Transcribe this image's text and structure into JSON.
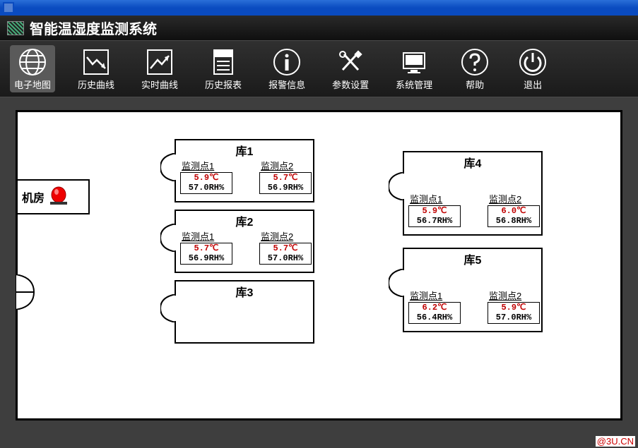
{
  "app": {
    "title": "智能温湿度监测系统"
  },
  "toolbar": {
    "items": [
      {
        "id": "map",
        "label": "电子地图",
        "active": true
      },
      {
        "id": "history-curve",
        "label": "历史曲线",
        "active": false
      },
      {
        "id": "realtime-curve",
        "label": "实时曲线",
        "active": false
      },
      {
        "id": "history-report",
        "label": "历史报表",
        "active": false
      },
      {
        "id": "alarm-info",
        "label": "报警信息",
        "active": false
      },
      {
        "id": "param-set",
        "label": "参数设置",
        "active": false
      },
      {
        "id": "sys-manage",
        "label": "系统管理",
        "active": false
      },
      {
        "id": "help",
        "label": "帮助",
        "active": false
      },
      {
        "id": "exit",
        "label": "退出",
        "active": false
      }
    ]
  },
  "machine_room": {
    "label": "机房"
  },
  "rooms": {
    "r1": {
      "title": "库1",
      "s1": {
        "name": "监测点1",
        "temp": "5.9℃",
        "hum": "57.0RH%"
      },
      "s2": {
        "name": "监测点2",
        "temp": "5.7℃",
        "hum": "56.9RH%"
      }
    },
    "r2": {
      "title": "库2",
      "s1": {
        "name": "监测点1",
        "temp": "5.7℃",
        "hum": "56.9RH%"
      },
      "s2": {
        "name": "监测点2",
        "temp": "5.7℃",
        "hum": "57.0RH%"
      }
    },
    "r3": {
      "title": "库3"
    },
    "r4": {
      "title": "库4",
      "s1": {
        "name": "监测点1",
        "temp": "5.9℃",
        "hum": "56.7RH%"
      },
      "s2": {
        "name": "监测点2",
        "temp": "6.0℃",
        "hum": "56.8RH%"
      }
    },
    "r5": {
      "title": "库5",
      "s1": {
        "name": "监测点1",
        "temp": "6.2℃",
        "hum": "56.4RH%"
      },
      "s2": {
        "name": "监测点2",
        "temp": "5.9℃",
        "hum": "57.0RH%"
      }
    }
  },
  "watermark": "@3U.CN"
}
